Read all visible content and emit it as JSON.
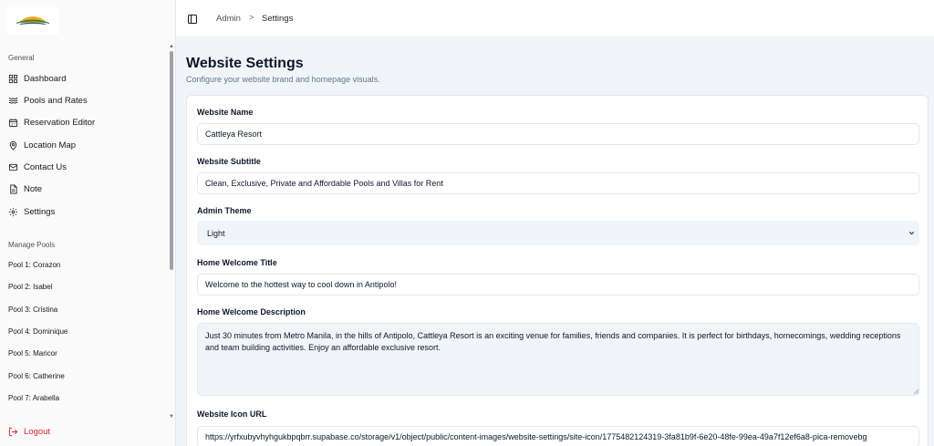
{
  "brand": {
    "logo_text": "Cattleya Resort"
  },
  "sidebar": {
    "group_general": "General",
    "items": [
      {
        "label": "Dashboard",
        "icon": "grid-icon"
      },
      {
        "label": "Pools and Rates",
        "icon": "waves-icon"
      },
      {
        "label": "Reservation Editor",
        "icon": "calendar-icon"
      },
      {
        "label": "Location Map",
        "icon": "map-pin-icon"
      },
      {
        "label": "Contact Us",
        "icon": "mail-icon"
      },
      {
        "label": "Note",
        "icon": "file-icon"
      },
      {
        "label": "Settings",
        "icon": "gear-icon"
      }
    ],
    "group_pools": "Manage Pools",
    "pools": [
      "Pool 1: Corazon",
      "Pool 2: Isabel",
      "Pool 3: Cristina",
      "Pool 4: Dominique",
      "Pool 5: Maricor",
      "Pool 6: Catherine",
      "Pool 7: Arabella"
    ],
    "logout": "Logout"
  },
  "header": {
    "breadcrumb_root": "Admin",
    "breadcrumb_sep": ">",
    "breadcrumb_current": "Settings"
  },
  "page": {
    "title": "Website Settings",
    "subtitle": "Configure your website brand and homepage visuals."
  },
  "form": {
    "website_name_label": "Website Name",
    "website_name_value": "Cattleya Resort",
    "website_subtitle_label": "Website Subtitle",
    "website_subtitle_value": "Clean, Exclusive, Private and Affordable Pools and Villas for Rent",
    "admin_theme_label": "Admin Theme",
    "admin_theme_value": "Light",
    "home_title_label": "Home Welcome Title",
    "home_title_value": "Welcome to the hottest way to cool down in Antipolo!",
    "home_desc_label": "Home Welcome Description",
    "home_desc_value": "Just 30 minutes from Metro Manila, in the hills of Antipolo, Cattleya Resort is an exciting venue for families, friends and companies. It is perfect for birthdays, homecomings, wedding receptions and team building activities. Enjoy an affordable exclusive resort.",
    "icon_url_label": "Website Icon URL",
    "icon_url_value": "https://yrfxubyvhyhgukbpqbrr.supabase.co/storage/v1/object/public/content-images/website-settings/site-icon/1775482124319-3fa81b9f-6e20-48fe-99ea-49a7f12ef6a8-pica-removebg"
  }
}
